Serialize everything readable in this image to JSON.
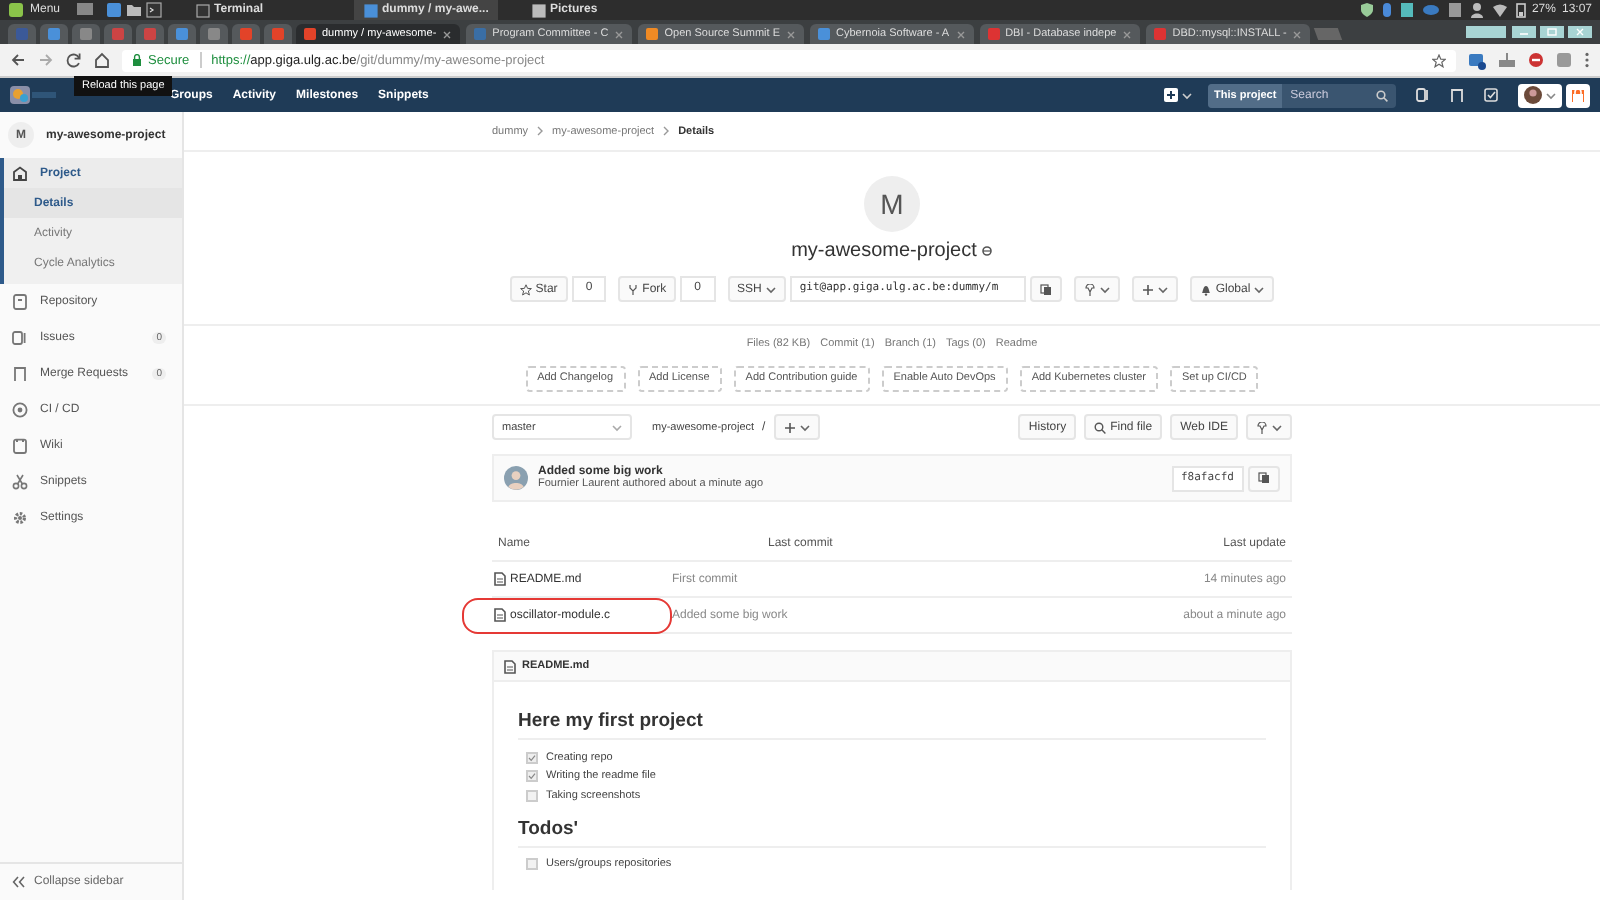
{
  "os_panel": {
    "menu": "Menu",
    "tasks": [
      {
        "label": "Terminal",
        "selected": false
      },
      {
        "label": "dummy / my-awe...",
        "selected": true
      },
      {
        "label": "Pictures",
        "selected": false
      }
    ],
    "battery": "27%",
    "clock": "13:07"
  },
  "browser": {
    "tabs": [
      {
        "title": "dummy / my-awesome-",
        "selected": true
      },
      {
        "title": "Program Committee - C",
        "selected": false
      },
      {
        "title": "Open Source Summit E",
        "selected": false
      },
      {
        "title": "Cybernoia Software - A",
        "selected": false
      },
      {
        "title": "DBI - Database indepe",
        "selected": false
      },
      {
        "title": "DBD::mysql::INSTALL -",
        "selected": false
      }
    ],
    "secure_label": "Secure",
    "url_scheme": "https://",
    "url_host": "app.giga.ulg.ac.be",
    "url_path": "/git/dummy/my-awesome-project",
    "tooltip": "Reload this page"
  },
  "top_nav": {
    "links": [
      "Groups",
      "Activity",
      "Milestones",
      "Snippets"
    ],
    "search_scope": "This project",
    "search": {
      "placeholder": "Search"
    }
  },
  "sidebar": {
    "avatar": "M",
    "project": "my-awesome-project",
    "items": [
      {
        "label": "Project",
        "selected": true,
        "expanded": true,
        "children": [
          {
            "label": "Details",
            "selected": true
          },
          {
            "label": "Activity",
            "selected": false
          },
          {
            "label": "Cycle Analytics",
            "selected": false
          }
        ]
      },
      {
        "label": "Repository",
        "selected": false
      },
      {
        "label": "Issues",
        "count": "0",
        "selected": false
      },
      {
        "label": "Merge Requests",
        "count": "0",
        "selected": false
      },
      {
        "label": "CI / CD",
        "selected": false
      },
      {
        "label": "Wiki",
        "selected": false
      },
      {
        "label": "Snippets",
        "selected": false
      },
      {
        "label": "Settings",
        "selected": false
      }
    ],
    "collapse": "Collapse sidebar"
  },
  "breadcrumb": [
    "dummy",
    "my-awesome-project",
    "Details"
  ],
  "project": {
    "avatar": "M",
    "name": "my-awesome-project",
    "star": "Star",
    "star_count": "0",
    "fork": "Fork",
    "fork_count": "0",
    "protocol": "SSH",
    "clone_url": "git@app.giga.ulg.ac.be:dummy/m",
    "notification": "Global"
  },
  "stats": [
    "Files (82 KB)",
    "Commit (1)",
    "Branch (1)",
    "Tags (0)",
    "Readme"
  ],
  "actions": [
    "Add Changelog",
    "Add License",
    "Add Contribution guide",
    "Enable Auto DevOps",
    "Add Kubernetes cluster",
    "Set up CI/CD"
  ],
  "repo_bar": {
    "branch": "master",
    "path": "my-awesome-project",
    "separator": "/",
    "buttons": [
      "History",
      "Find file",
      "Web IDE"
    ]
  },
  "last_commit": {
    "message": "Added some big work",
    "author_line": "Fournier Laurent authored about a minute ago",
    "sha": "f8afacfd"
  },
  "files": {
    "columns": [
      "Name",
      "Last commit",
      "Last update"
    ],
    "rows": [
      {
        "name": "README.md",
        "commit": "First commit",
        "updated": "14 minutes ago",
        "highlighted": false
      },
      {
        "name": "oscillator-module.c",
        "commit": "Added some big work",
        "updated": "about a minute ago",
        "highlighted": true
      }
    ]
  },
  "readme": {
    "filename": "README.md",
    "sections": [
      {
        "heading": "Here my first project",
        "tasks": [
          {
            "text": "Creating repo",
            "checked": true
          },
          {
            "text": "Writing the readme file",
            "checked": true
          },
          {
            "text": "Taking screenshots",
            "checked": false
          }
        ]
      },
      {
        "heading": "Todos'",
        "tasks": [
          {
            "text": "Users/groups repositories",
            "checked": false
          }
        ]
      }
    ]
  }
}
